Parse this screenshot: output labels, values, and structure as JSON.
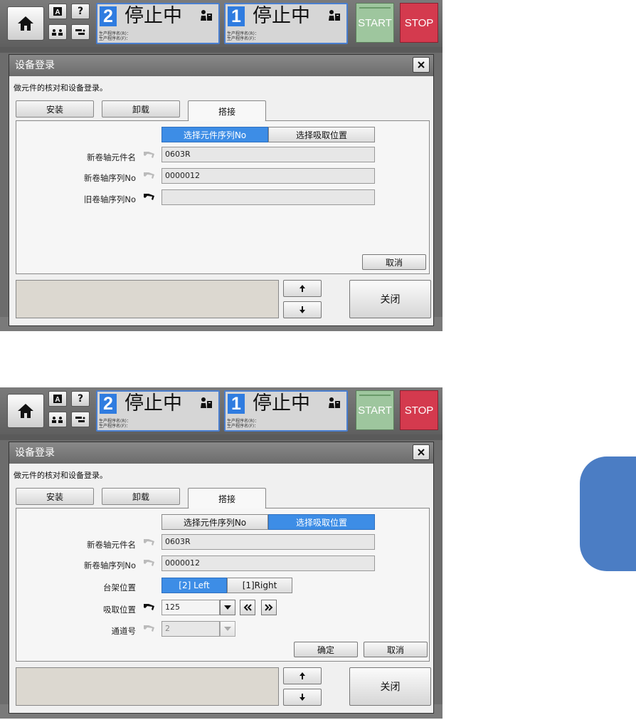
{
  "topbar": {
    "help_label": "?",
    "lanes": [
      {
        "number": "2",
        "status": "停止中",
        "prog_r": "生产程序名(R)：",
        "prog_f": "生产程序名(F)："
      },
      {
        "number": "1",
        "status": "停止中",
        "prog_r": "生产程序名(R)：",
        "prog_f": "生产程序名(F)："
      }
    ],
    "start_label": "START",
    "stop_label": "STOP",
    "colors": {
      "start": "#9ec69e",
      "stop": "#d43a4e",
      "lane_accent": "#2f7ce0"
    }
  },
  "dialog": {
    "title": "设备登录",
    "description": "做元件的核对和设备登录。",
    "tabs": [
      "安装",
      "卸载",
      "搭接"
    ],
    "active_tab": "搭接",
    "mode_buttons": [
      "选择元件序列No",
      "选择吸取位置"
    ],
    "close_label": "关闭"
  },
  "screen1": {
    "selected_mode": "选择元件序列No",
    "rows": [
      {
        "label": "新卷轴元件名",
        "value": "0603R"
      },
      {
        "label": "新卷轴序列No",
        "value": "0000012"
      },
      {
        "label": "旧卷轴序列No",
        "value": ""
      }
    ],
    "cancel_label": "取消"
  },
  "screen2": {
    "selected_mode": "选择吸取位置",
    "rows": [
      {
        "label": "新卷轴元件名",
        "value": "0603R"
      },
      {
        "label": "新卷轴序列No",
        "value": "0000012"
      }
    ],
    "rack": {
      "label": "台架位置",
      "options": [
        "[2] Left",
        "[1]Right"
      ],
      "selected": "[2] Left"
    },
    "pickup": {
      "label": "吸取位置",
      "value": "125"
    },
    "lane": {
      "label": "通道号",
      "value": "2"
    },
    "ok_label": "确定",
    "cancel_label": "取消"
  },
  "icons": [
    "home-icon",
    "mode-a-icon",
    "operators-icon",
    "settings-icon",
    "barcode-hand-icon",
    "close-icon",
    "arrow-up-icon",
    "arrow-down-icon",
    "chevron-double-left-icon",
    "chevron-double-right-icon",
    "dropdown-arrow-icon"
  ]
}
